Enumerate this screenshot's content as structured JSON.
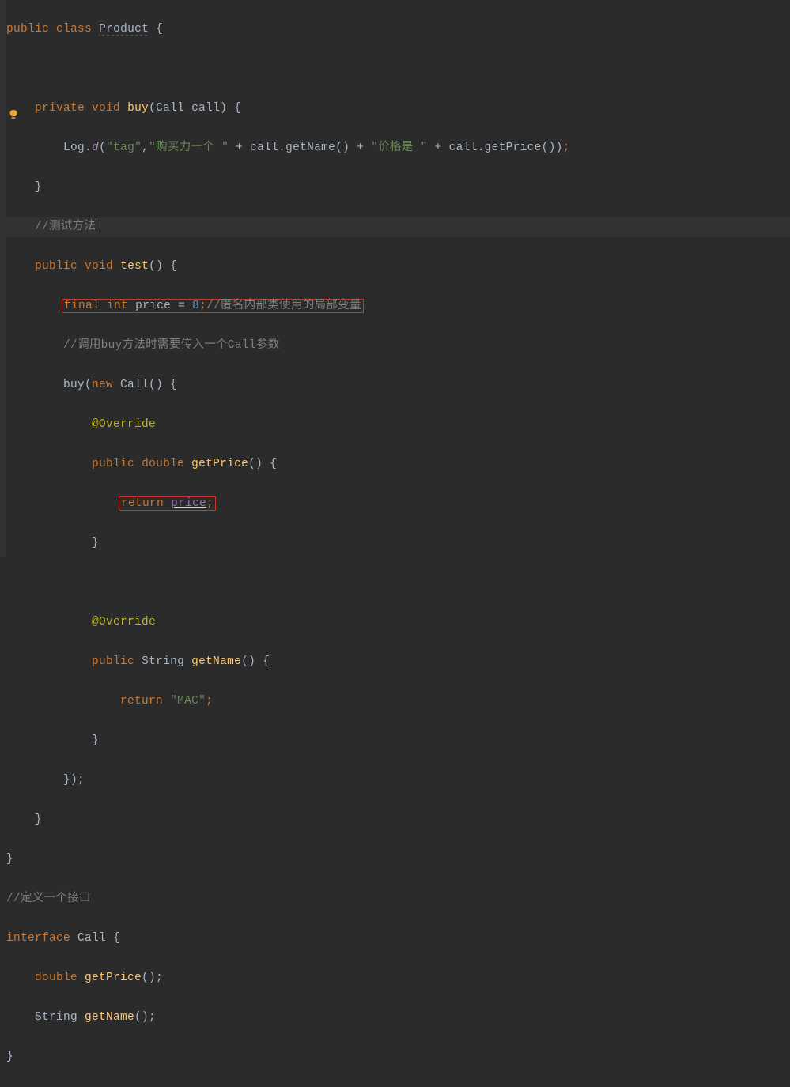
{
  "code": {
    "l1_kw1": "public",
    "l1_kw2": "class",
    "l1_class": "Product",
    "l1_brace": " {",
    "l2_kw1": "private",
    "l2_kw2": "void",
    "l2_method": "buy",
    "l2_sig": "(Call call) {",
    "l3_log": "Log",
    "l3_dot": ".",
    "l3_d": "d",
    "l3_p1": "(",
    "l3_s1": "\"tag\"",
    "l3_c1": ",",
    "l3_s2": "\"购买力一个 \"",
    "l3_plus1": " + ",
    "l3_call1": "call.getName()",
    "l3_plus2": " + ",
    "l3_s3": "\"价格是 \"",
    "l3_plus3": " + ",
    "l3_call2": "call.getPrice())",
    "l3_semi": ";",
    "l4_brace": "}",
    "l5_comment": "//测试方法",
    "l6_kw1": "public",
    "l6_kw2": "void",
    "l6_method": "test",
    "l6_sig": "() {",
    "l7_kw1": "final",
    "l7_kw2": "int",
    "l7_var": "price",
    "l7_eq": " = ",
    "l7_num": "8",
    "l7_semi": ";",
    "l7_comment": "//匿名内部类使用的局部变量",
    "l8_comment": "//调用buy方法时需要传入一个Call参数",
    "l9_buy": "buy(",
    "l9_kw": "new",
    "l9_call": " Call() {",
    "l10_ann": "@Override",
    "l11_kw1": "public",
    "l11_kw2": "double",
    "l11_method": "getPrice",
    "l11_sig": "() {",
    "l12_kw": "return",
    "l12_sp": " ",
    "l12_var": "price",
    "l12_semi": ";",
    "l13_brace": "}",
    "l15_ann": "@Override",
    "l16_kw1": "public",
    "l16_type": "String",
    "l16_method": "getName",
    "l16_sig": "() {",
    "l17_kw": "return",
    "l17_sp": " ",
    "l17_str": "\"MAC\"",
    "l17_semi": ";",
    "l18_brace": "}",
    "l19_close": "});",
    "l20_brace": "}",
    "l21_brace": "}",
    "l22_comment": "//定义一个接口",
    "l23_kw": "interface",
    "l23_name": " Call {",
    "l24_kw": "double",
    "l24_method": " getPrice",
    "l24_sig": "();",
    "l25_type": "String ",
    "l25_method": "getName",
    "l25_sig": "();",
    "l26_brace": "}"
  }
}
